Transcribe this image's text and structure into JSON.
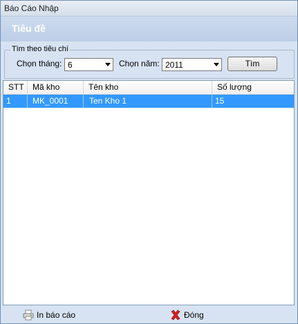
{
  "window": {
    "title": "Báo Cáo Nhập"
  },
  "header": {
    "title": "Tiêu đề"
  },
  "filter": {
    "group_title": "Tìm theo tiêu chí",
    "month_label": "Chọn tháng:",
    "month_value": "6",
    "year_label": "Chọn năm:",
    "year_value": "2011",
    "search_label": "Tìm"
  },
  "grid": {
    "columns": [
      "STT",
      "Mã kho",
      "Tên kho",
      "Số lượng"
    ],
    "rows": [
      {
        "stt": "1",
        "ma_kho": "MK_0001",
        "ten_kho": "Ten Kho 1",
        "so_luong": "15",
        "selected": true
      }
    ],
    "selection_color": "#3399ff"
  },
  "footer": {
    "print_label": "In báo cáo",
    "print_icon": "printer-icon",
    "close_label": "Đóng",
    "close_icon": "close-x-icon",
    "close_icon_color": "#d42020"
  }
}
